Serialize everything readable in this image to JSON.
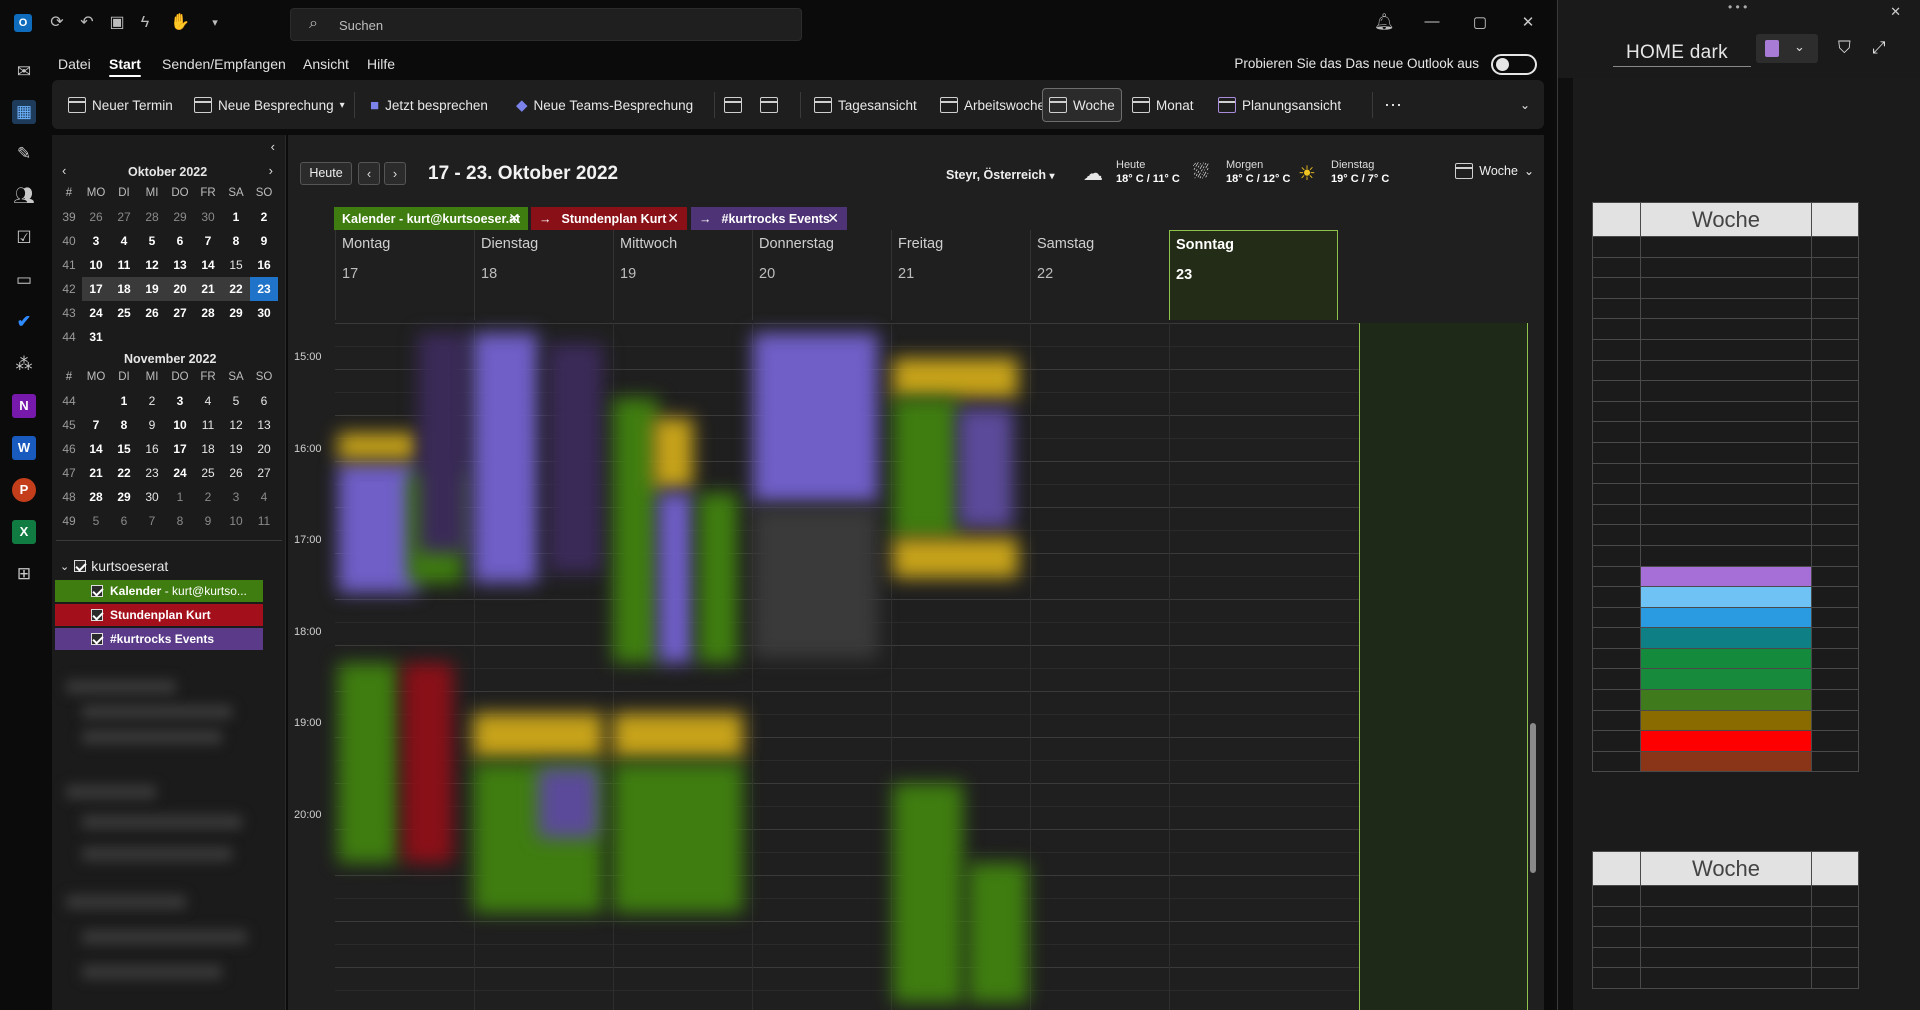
{
  "titlebar": {
    "search_placeholder": "Suchen"
  },
  "menu": {
    "items": [
      "Datei",
      "Start",
      "Senden/Empfangen",
      "Ansicht",
      "Hilfe"
    ],
    "active": "Start",
    "try_new": "Probieren Sie das Das neue Outlook aus"
  },
  "ribbon": {
    "new_appointment": "Neuer Termin",
    "new_meeting": "Neue Besprechung",
    "meet_now": "Jetzt besprechen",
    "new_teams_meeting": "Neue Teams-Besprechung",
    "day_view": "Tagesansicht",
    "work_week": "Arbeitswoche",
    "week": "Woche",
    "month": "Monat",
    "schedule_view": "Planungsansicht",
    "more": "⋯"
  },
  "minical": {
    "october": {
      "title": "Oktober 2022",
      "headers": [
        "#",
        "MO",
        "DI",
        "MI",
        "DO",
        "FR",
        "SA",
        "SO"
      ],
      "rows": [
        [
          "39",
          "26",
          "27",
          "28",
          "29",
          "30",
          "1",
          "2"
        ],
        [
          "40",
          "3",
          "4",
          "5",
          "6",
          "7",
          "8",
          "9"
        ],
        [
          "41",
          "10",
          "11",
          "12",
          "13",
          "14",
          "15",
          "16"
        ],
        [
          "42",
          "17",
          "18",
          "19",
          "20",
          "21",
          "22",
          "23"
        ],
        [
          "43",
          "24",
          "25",
          "26",
          "27",
          "28",
          "29",
          "30"
        ],
        [
          "44",
          "31"
        ]
      ]
    },
    "november": {
      "title": "November 2022",
      "headers": [
        "#",
        "MO",
        "DI",
        "MI",
        "DO",
        "FR",
        "SA",
        "SO"
      ],
      "rows": [
        [
          "44",
          "",
          "1",
          "2",
          "3",
          "4",
          "5",
          "6"
        ],
        [
          "45",
          "7",
          "8",
          "9",
          "10",
          "11",
          "12",
          "13"
        ],
        [
          "46",
          "14",
          "15",
          "16",
          "17",
          "18",
          "19",
          "20"
        ],
        [
          "47",
          "21",
          "22",
          "23",
          "24",
          "25",
          "26",
          "27"
        ],
        [
          "48",
          "28",
          "29",
          "30",
          "1",
          "2",
          "3",
          "4"
        ],
        [
          "49",
          "5",
          "6",
          "7",
          "8",
          "9",
          "10",
          "11"
        ]
      ]
    }
  },
  "calendars": {
    "group": "kurtsoeserat",
    "items": [
      {
        "name": "Kalender",
        "sub": " - kurt@kurtso...",
        "color": "#3f7d10"
      },
      {
        "name": "Stundenplan Kurt",
        "sub": "",
        "color": "#a3101c"
      },
      {
        "name": "#kurtrocks Events",
        "sub": "",
        "color": "#5b3a8a"
      }
    ]
  },
  "calview": {
    "today_button": "Heute",
    "date_range": "17 - 23. Oktober 2022",
    "location": "Steyr, Österreich",
    "weather": [
      {
        "day": "Heute",
        "temp": "18° C / 11° C"
      },
      {
        "day": "Morgen",
        "temp": "18° C / 12° C"
      },
      {
        "day": "Dienstag",
        "temp": "19° C / 7° C"
      }
    ],
    "view_selector": "Woche",
    "tabs": [
      {
        "label": "Kalender - kurt@kurtsoeser.at",
        "color": "#3f7d10"
      },
      {
        "label": "Stundenplan Kurt",
        "color": "#8a1018"
      },
      {
        "label": "#kurtrocks Events",
        "color": "#4e3376"
      }
    ],
    "days": [
      {
        "name": "Montag",
        "date": "17"
      },
      {
        "name": "Dienstag",
        "date": "18"
      },
      {
        "name": "Mittwoch",
        "date": "19"
      },
      {
        "name": "Donnerstag",
        "date": "20"
      },
      {
        "name": "Freitag",
        "date": "21"
      },
      {
        "name": "Samstag",
        "date": "22"
      },
      {
        "name": "Sonntag",
        "date": "23"
      }
    ],
    "hours": [
      "15:00",
      "16:00",
      "17:00",
      "18:00",
      "19:00",
      "20:00"
    ]
  },
  "onenote": {
    "title": "HOME dark",
    "table_title": "Woche",
    "swatches": [
      "#a66fd8",
      "#6ec3f4",
      "#2a9be0",
      "#0f7f86",
      "#138a3c",
      "#178a3c",
      "#3f7a1c",
      "#8a6b00",
      "#ff0000",
      "#8a3418"
    ]
  }
}
